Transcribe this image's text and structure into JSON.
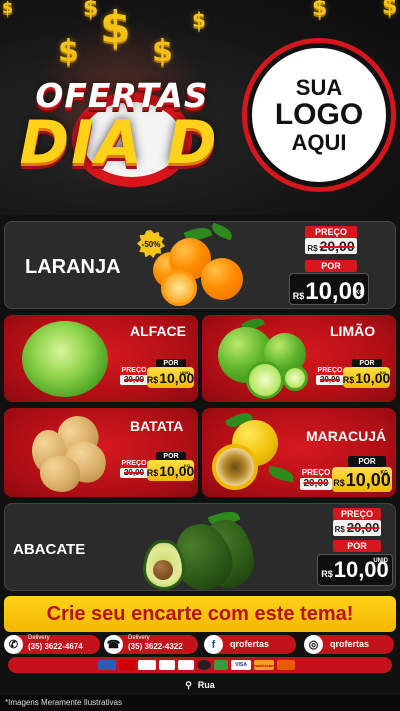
{
  "header": {
    "promo_top": "OFERTAS",
    "promo_bottom": "DIA D",
    "logo_lines": [
      "SUA",
      "LOGO",
      "AQUI"
    ]
  },
  "products": {
    "laranja": {
      "name": "LARANJA",
      "badge": "-50%",
      "preco_label": "PREÇO",
      "old_currency": "R$",
      "old_price": "20,00",
      "por_label": "POR",
      "currency": "R$",
      "price": "10,00",
      "unit": "KG"
    },
    "alface": {
      "name": "ALFACE",
      "preco_label": "PREÇO",
      "old_price": "20,00",
      "por_label": "POR",
      "currency": "R$",
      "price": "10,00",
      "unit": "UNID"
    },
    "limao": {
      "name": "LIMÃO",
      "preco_label": "PREÇO",
      "old_price": "20,00",
      "por_label": "POR",
      "currency": "R$",
      "price": "10,00",
      "unit": "KG"
    },
    "batata": {
      "name": "BATATA",
      "preco_label": "PREÇO",
      "old_price": "20,00",
      "por_label": "POR",
      "currency": "R$",
      "price": "10,00",
      "unit": "KG"
    },
    "maracuja": {
      "name": "MARACUJÁ",
      "preco_label": "PREÇO",
      "old_price": "20,00",
      "por_label": "POR",
      "currency": "R$",
      "price": "10,00",
      "unit": "KG"
    },
    "abacate": {
      "name": "ABACATE",
      "preco_label": "PREÇO",
      "old_currency": "R$",
      "old_price": "20,00",
      "por_label": "POR",
      "currency": "R$",
      "price": "10,00",
      "unit": "UNID"
    }
  },
  "footer": {
    "cta": "Crie seu encarte com este tema!",
    "contacts": [
      {
        "icon": "whatsapp-icon",
        "label": "Delivery",
        "text": "(35) 3622-4674"
      },
      {
        "icon": "phone-icon",
        "label": "Delivery",
        "text": "(35) 3622-4322"
      },
      {
        "icon": "facebook-icon",
        "text": "qrofertas"
      },
      {
        "icon": "instagram-icon",
        "text": "qrofertas"
      }
    ],
    "payment_methods": [
      "",
      "",
      "",
      "",
      "",
      "",
      "",
      "VISA",
      "mastercard",
      ""
    ],
    "address": "Rua",
    "disclaimer": "*Imagens Meramente Ilustrativas"
  },
  "colors": {
    "brand_red": "#d7151c",
    "brand_yellow": "#ffd21a",
    "dark": "#111111"
  }
}
